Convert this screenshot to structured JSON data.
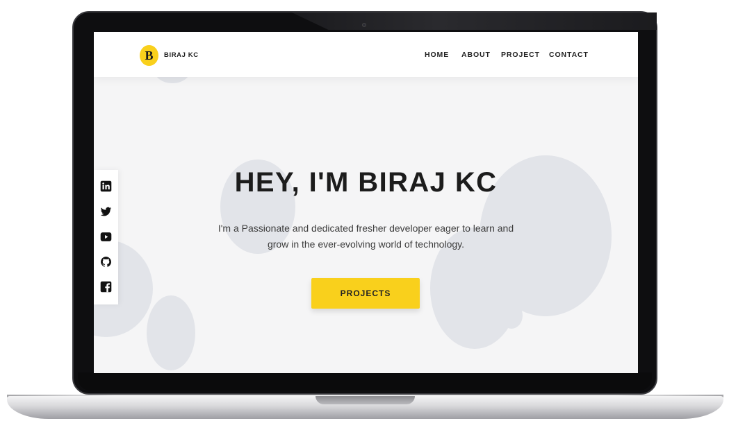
{
  "brand": {
    "initial": "B",
    "name": "BIRAJ KC"
  },
  "nav": {
    "home": "HOME",
    "about": "ABOUT",
    "project": "PROJECT",
    "contact": "CONTACT"
  },
  "hero": {
    "title": "HEY, I'M BIRAJ KC",
    "subtitle": "I'm a Passionate and dedicated fresher developer eager to learn and grow in the ever-evolving world of technology.",
    "cta": "PROJECTS"
  },
  "social_icons": [
    "linkedin-icon",
    "twitter-icon",
    "youtube-icon",
    "github-icon",
    "facebook-icon"
  ],
  "colors": {
    "accent": "#f9d01c",
    "background": "#f5f5f6",
    "blob": "#e2e4e9",
    "text": "#1c1c1c"
  }
}
